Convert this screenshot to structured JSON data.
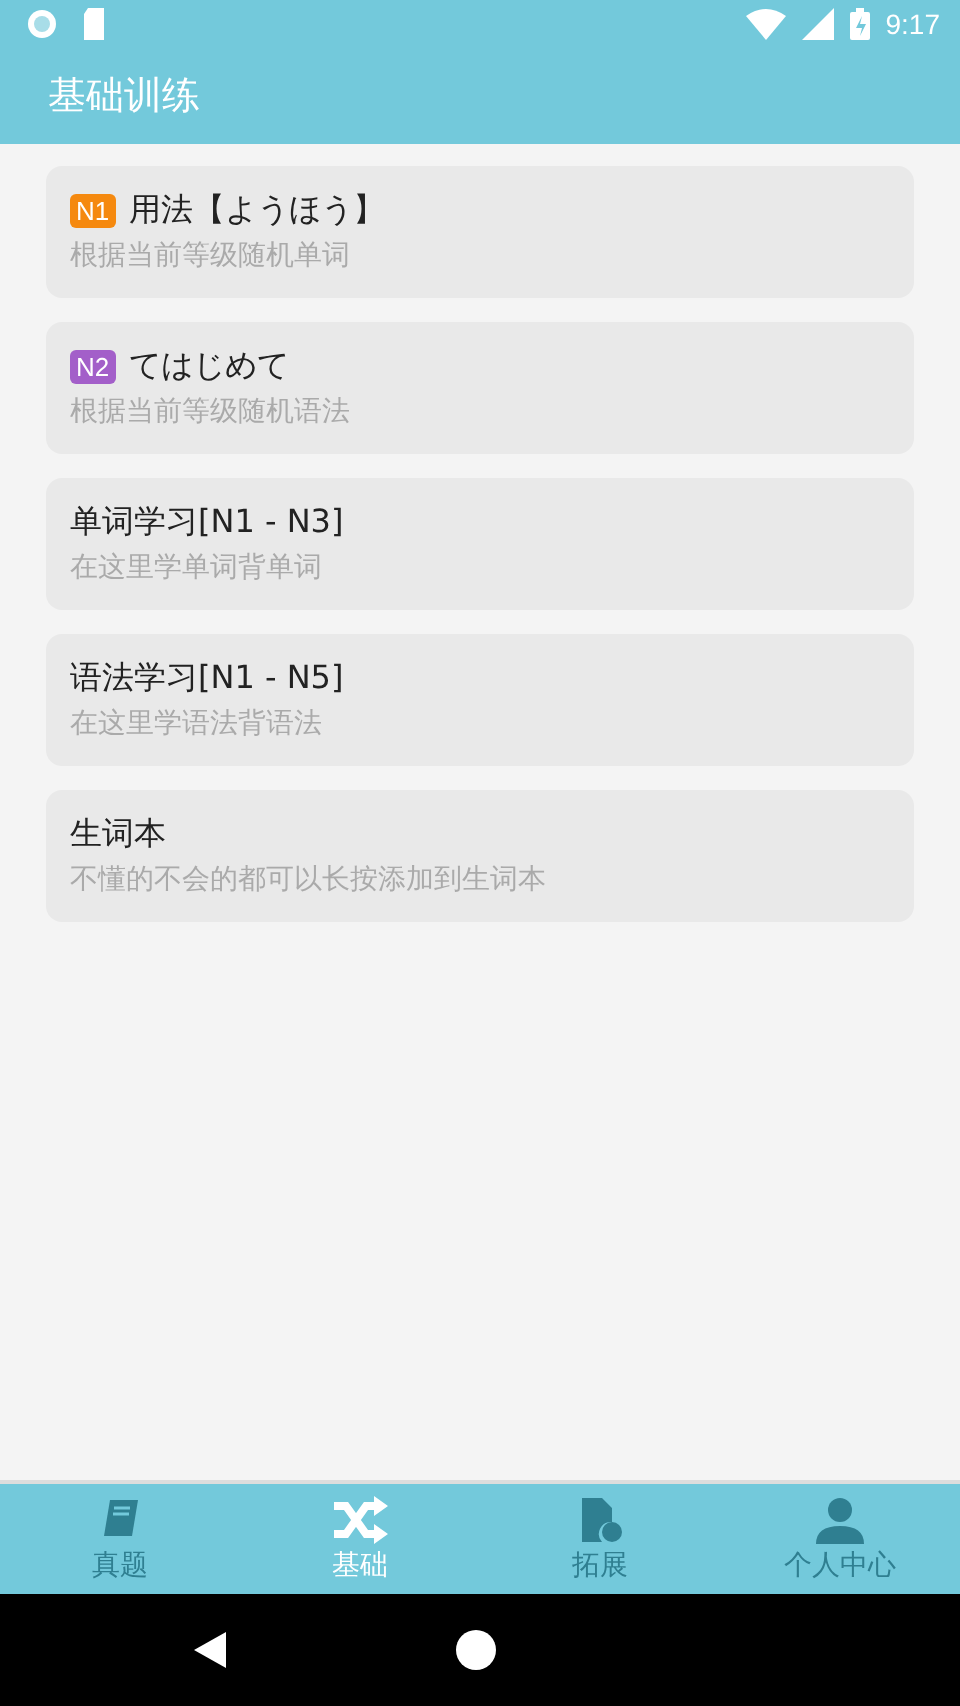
{
  "status_bar": {
    "time": "9:17"
  },
  "app_bar": {
    "title": "基础训练"
  },
  "cards": [
    {
      "badge": {
        "text": "N1",
        "color": "#f5890f"
      },
      "title": "用法【ようほう】",
      "subtitle": "根据当前等级随机单词"
    },
    {
      "badge": {
        "text": "N2",
        "color": "#a35fc9"
      },
      "title": "てはじめて",
      "subtitle": "根据当前等级随机语法"
    },
    {
      "title": "单词学习[N1 - N3]",
      "subtitle": "在这里学单词背单词"
    },
    {
      "title": "语法学习[N1 - N5]",
      "subtitle": "在这里学语法背语法"
    },
    {
      "title": "生词本",
      "subtitle": "不懂的不会的都可以长按添加到生词本"
    }
  ],
  "tabs": [
    {
      "label": "真题",
      "selected": false
    },
    {
      "label": "基础",
      "selected": true
    },
    {
      "label": "拓展",
      "selected": false
    },
    {
      "label": "个人中心",
      "selected": false
    }
  ]
}
